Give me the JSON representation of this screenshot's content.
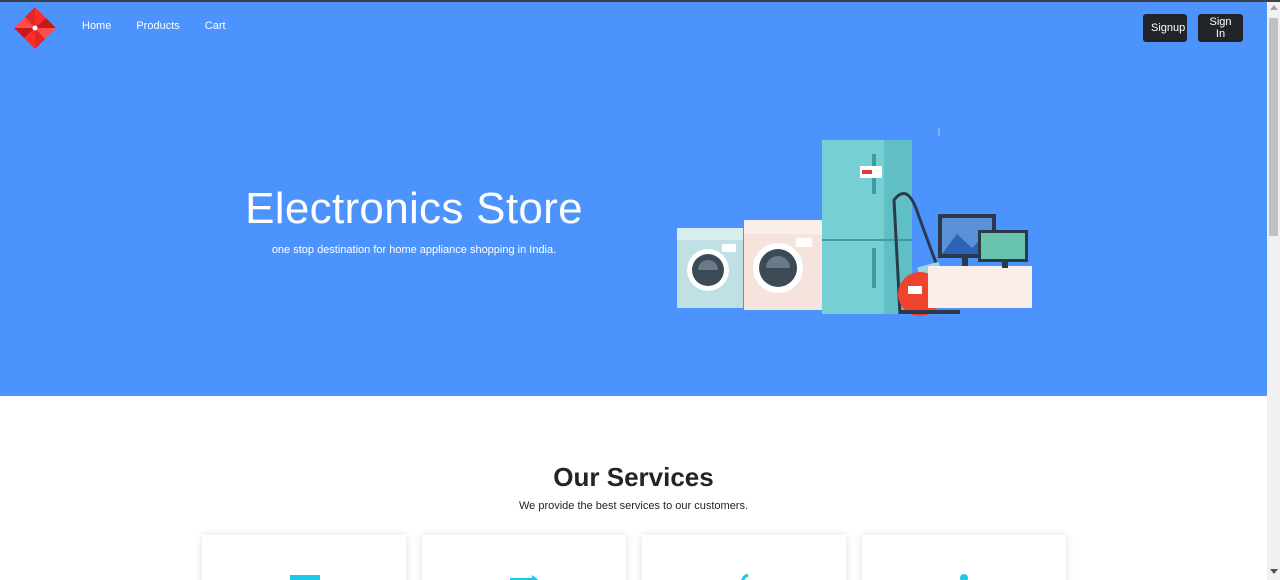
{
  "nav": {
    "links": [
      "Home",
      "Products",
      "Cart"
    ],
    "signup_label": "Signup",
    "signin_label": "Sign In"
  },
  "hero": {
    "title": "Electronics Store",
    "subtitle": "one stop destination for home appliance shopping in India."
  },
  "services": {
    "title": "Our Services",
    "subtitle": "We provide the best services to our customers.",
    "cards": [
      {
        "icon": "truck-icon"
      },
      {
        "icon": "exchange-arrow-icon"
      },
      {
        "icon": "dollar-icon"
      },
      {
        "icon": "info-icon"
      }
    ]
  },
  "colors": {
    "hero_bg": "#4c93fd",
    "button_bg": "#212529",
    "icon_color": "#1cc8e8"
  }
}
